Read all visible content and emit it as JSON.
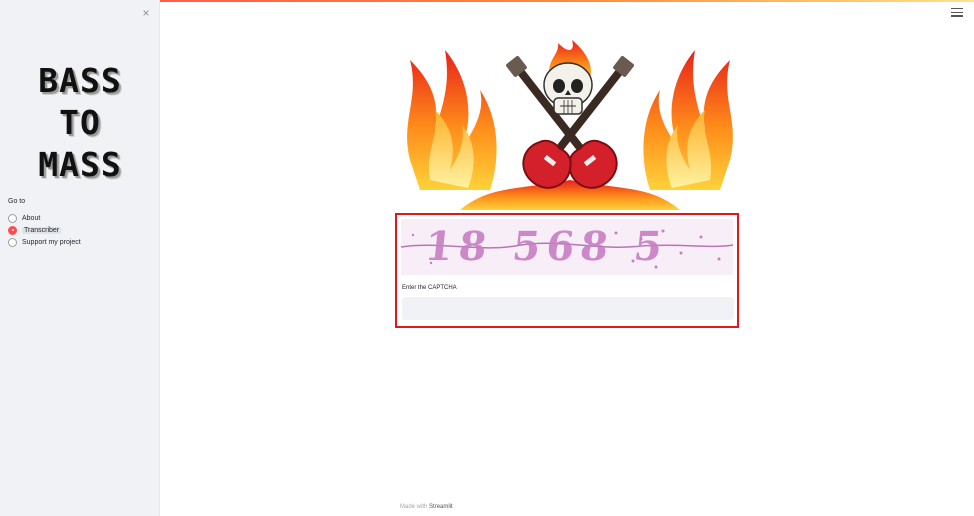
{
  "sidebar": {
    "close_icon": "×",
    "logo_text": "BASS\nTO\nMASS",
    "nav_label": "Go to",
    "options": [
      {
        "label": "About",
        "selected": false
      },
      {
        "label": "Transcriber",
        "selected": true
      },
      {
        "label": "Support my project",
        "selected": false
      }
    ]
  },
  "header": {
    "menu_icon": "hamburger-menu-icon"
  },
  "main": {
    "hero_image": "flaming-skull-crossed-guitars",
    "captcha": {
      "image_text": "18 568 5",
      "label": "Enter the CAPTCHA",
      "input_value": ""
    }
  },
  "footer": {
    "made_with": "Made with",
    "brand": "Streamlit"
  },
  "colors": {
    "accent": "#ff4b4b",
    "highlight_border": "#e0171d",
    "sidebar_bg": "#f0f2f6",
    "captcha_ink": "#c87ec4"
  }
}
